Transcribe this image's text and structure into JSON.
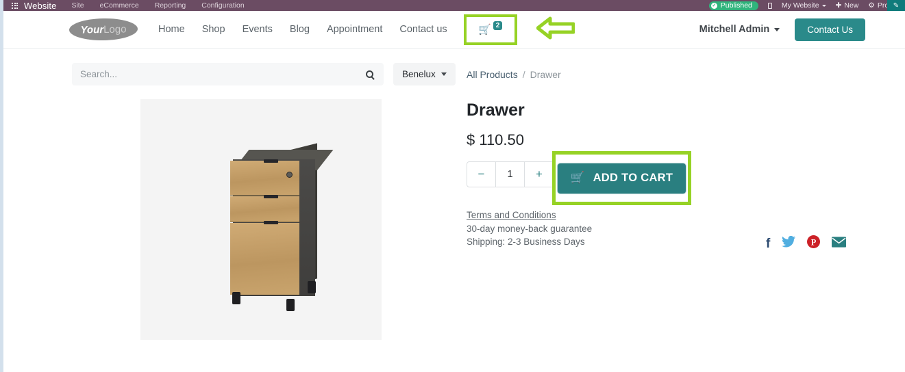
{
  "odoo_bar": {
    "apps_icon": "apps-grid-icon",
    "brand": "Website",
    "menu": [
      "Site",
      "eCommerce",
      "Reporting",
      "Configuration"
    ],
    "published_label": "Published",
    "published_color": "#2fb47c",
    "mobile_icon": "mobile-preview-icon",
    "website_selector": "My Website",
    "new_label": "New",
    "product_label": "Product",
    "edit_icon": "pencil-edit-icon",
    "bar_color": "#6b4c63"
  },
  "site_header": {
    "logo": {
      "part1": "Your",
      "part2": "Logo"
    },
    "nav": [
      "Home",
      "Shop",
      "Events",
      "Blog",
      "Appointment",
      "Contact us"
    ],
    "cart": {
      "icon": "shopping-cart-icon",
      "count": "2",
      "highlight_color": "#96d225"
    },
    "annotation_arrow": "green-left-arrow",
    "user": "Mitchell Admin",
    "contact_button": "Contact Us",
    "accent_color": "#2a8a8a"
  },
  "search": {
    "placeholder": "Search...",
    "icon": "search-icon",
    "region_filter": "Benelux"
  },
  "breadcrumb": {
    "parent": "All Products",
    "separator": "/",
    "current": "Drawer"
  },
  "product": {
    "image_alt": "drawer-cabinet-image",
    "title": "Drawer",
    "price": "$ 110.50",
    "quantity": "1",
    "decrease_label": "−",
    "increase_label": "+",
    "add_to_cart_label": "ADD TO CART",
    "add_to_cart_icon": "shopping-cart-icon",
    "add_to_cart_color": "#2a7f80",
    "highlight_color": "#96d225",
    "terms_link": "Terms and Conditions",
    "guarantee": "30-day money-back guarantee",
    "shipping": "Shipping: 2-3 Business Days"
  },
  "socials": [
    {
      "name": "facebook",
      "glyph": "f",
      "color": "#2c4a70"
    },
    {
      "name": "twitter",
      "glyph": "ᵥ",
      "color": "#51aee0"
    },
    {
      "name": "pinterest",
      "glyph": "P",
      "color": "#cc2127"
    },
    {
      "name": "email",
      "glyph": "✉",
      "color": "#2a7f80"
    }
  ]
}
